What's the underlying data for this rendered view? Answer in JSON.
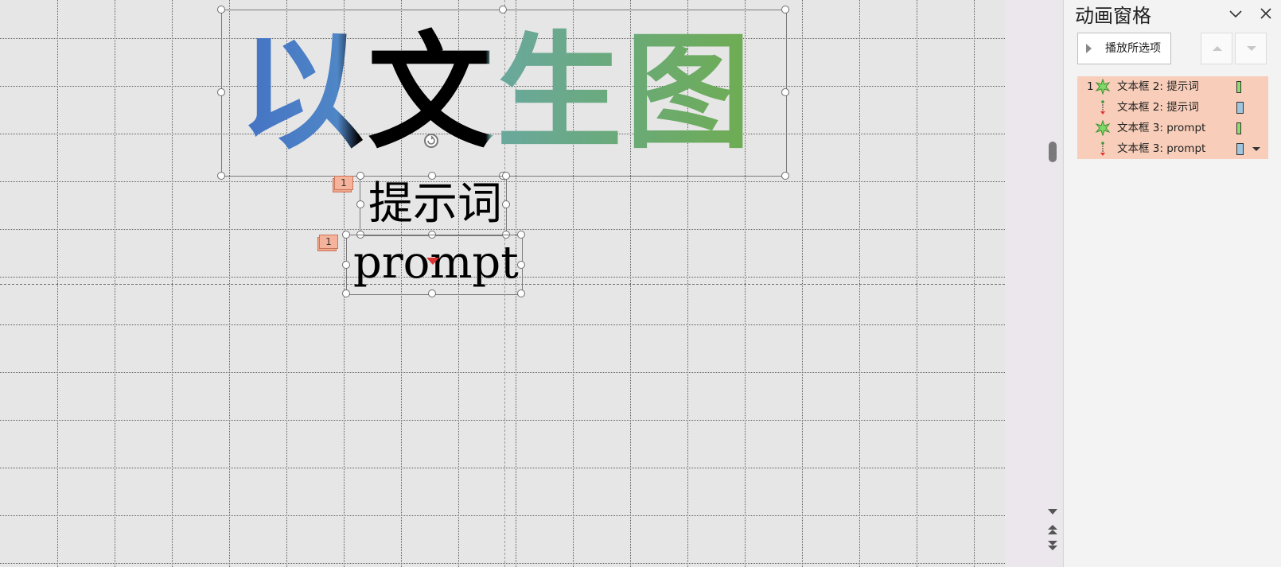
{
  "slide": {
    "title_text": "以文生图",
    "box2_text": "提示词",
    "box3_text": "prompt",
    "tag2_number": "1",
    "tag3_number": "1"
  },
  "animation_pane": {
    "title": "动画窗格",
    "collapse_icon": "chevron-down-icon",
    "close_icon": "close-icon",
    "play_label": "播放所选项",
    "move_up_icon": "triangle-up-icon",
    "move_down_icon": "triangle-down-icon",
    "items": [
      {
        "order": "1",
        "effect_icon": "star-burst-icon",
        "label": "文本框 2: 提示词",
        "bar_color": "#8fdc6e"
      },
      {
        "order": "",
        "effect_icon": "motion-path-icon",
        "label": "文本框 2: 提示词",
        "bar_color": "#9ec6e0"
      },
      {
        "order": "",
        "effect_icon": "star-burst-icon",
        "label": "文本框 3: prompt",
        "bar_color": "#8fdc6e"
      },
      {
        "order": "",
        "effect_icon": "motion-path-icon",
        "label": "文本框 3: prompt",
        "bar_color": "#9ec6e0"
      }
    ],
    "list_highlight_color": "#f8cdb9"
  },
  "colors": {
    "title_gradient_start": "#4472c4",
    "title_gradient_end": "#70ad47",
    "tag_color": "#f6b39b"
  }
}
